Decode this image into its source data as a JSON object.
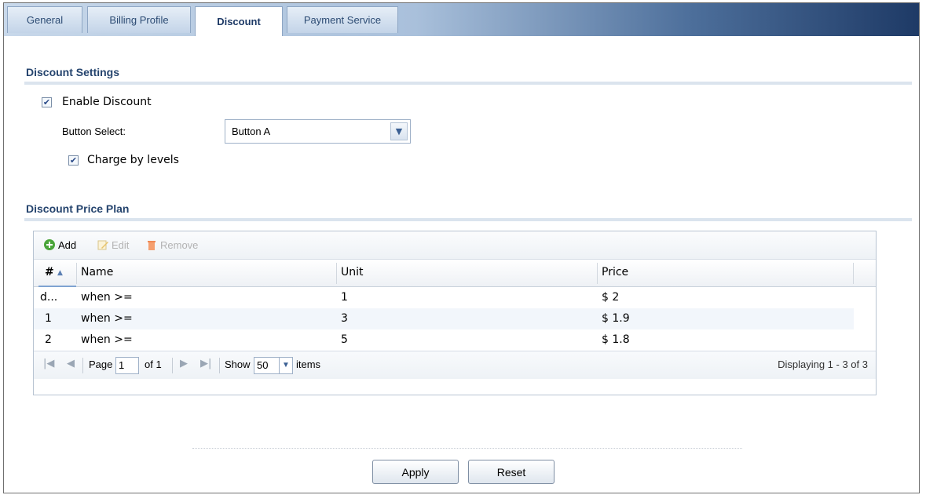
{
  "tabs": [
    {
      "label": "General"
    },
    {
      "label": "Billing Profile"
    },
    {
      "label": "Discount"
    },
    {
      "label": "Payment Service"
    }
  ],
  "discount_settings": {
    "title": "Discount Settings",
    "enable_discount_label": "Enable Discount",
    "enable_discount_checked": true,
    "button_select_label": "Button Select:",
    "button_select_value": "Button A",
    "charge_by_levels_label": "Charge by levels",
    "charge_by_levels_checked": true
  },
  "price_plan": {
    "title": "Discount Price Plan",
    "toolbar": {
      "add": "Add",
      "edit": "Edit",
      "remove": "Remove"
    },
    "columns": {
      "num": "#",
      "name": "Name",
      "unit": "Unit",
      "price": "Price"
    },
    "rows": [
      {
        "num": "d...",
        "name": "when >=",
        "unit": "1",
        "price": "$ 2"
      },
      {
        "num": "1",
        "name": "when >=",
        "unit": "3",
        "price": "$ 1.9"
      },
      {
        "num": "2",
        "name": "when >=",
        "unit": "5",
        "price": "$ 1.8"
      }
    ],
    "pager": {
      "page_label": "Page",
      "page_value": "1",
      "of_label": "of 1",
      "show_label": "Show",
      "show_value": "50",
      "items_label": "items",
      "displaying": "Displaying 1 - 3 of 3"
    }
  },
  "buttons": {
    "apply": "Apply",
    "reset": "Reset"
  }
}
